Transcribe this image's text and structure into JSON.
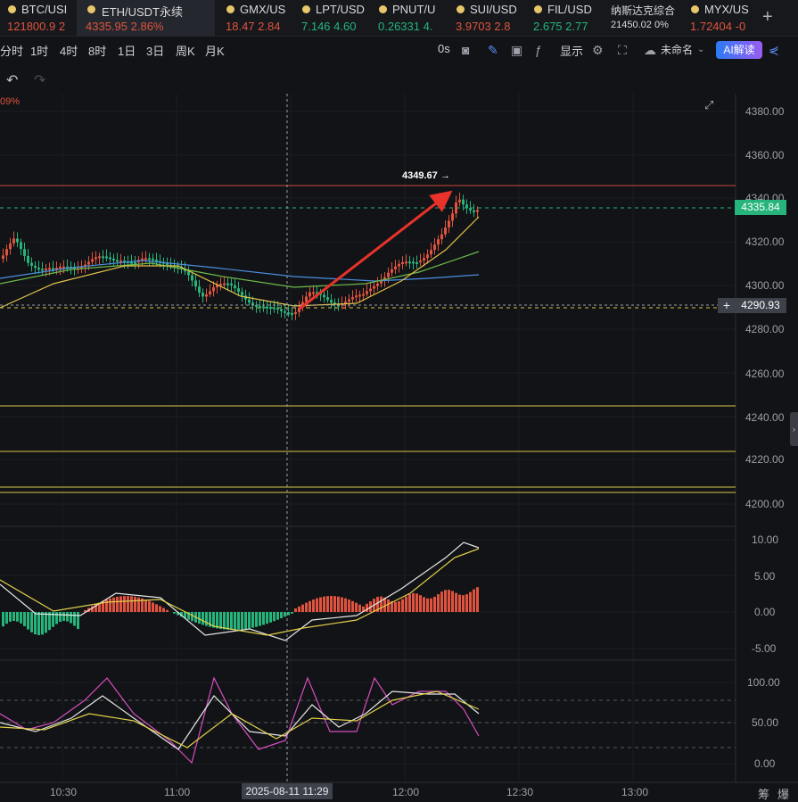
{
  "tabs": [
    {
      "symbol": "BTC/USI",
      "price": "121800.9",
      "change": "2",
      "color": "#e0533e",
      "active": false
    },
    {
      "symbol": "ETH/USDT永续",
      "price": "4335.95",
      "change": "2.86%",
      "color": "#e0533e",
      "active": true
    },
    {
      "symbol": "GMX/US",
      "price": "18.47",
      "change": "2.84",
      "color": "#e0533e",
      "active": false
    },
    {
      "symbol": "LPT/USD",
      "price": "7.146",
      "change": "4.60",
      "color": "#26b47b",
      "active": false
    },
    {
      "symbol": "PNUT/U",
      "price": "0.26331",
      "change": "4.",
      "color": "#26b47b",
      "active": false
    },
    {
      "symbol": "SUI/USD",
      "price": "3.9703",
      "change": "2.8",
      "color": "#e0533e",
      "active": false
    },
    {
      "symbol": "FIL/USD",
      "price": "2.675",
      "change": "2.77",
      "color": "#26b47b",
      "active": false
    },
    {
      "symbol": "纳斯达克综合",
      "price": "21450.02",
      "change": "0%",
      "color": "#d7d9de",
      "active": false
    },
    {
      "symbol": "MYX/US",
      "price": "1.72404",
      "change": "-0",
      "color": "#e0533e",
      "active": false
    }
  ],
  "toolbar": {
    "timeframes": [
      "分时",
      "1时",
      "4时",
      "8时",
      "1日",
      "3日",
      "周K",
      "月K"
    ],
    "countdown": "0s",
    "display_label": "显示",
    "layout_name": "未命名",
    "ai_label": "AI解读"
  },
  "chart": {
    "change_pct": "09%",
    "price_labels": [
      "4380.00",
      "4360.00",
      "4340.00",
      "4320.00",
      "4300.00",
      "4280.00",
      "4260.00",
      "4240.00",
      "4220.00",
      "4200.00"
    ],
    "macd_labels": [
      "10.00",
      "5.00",
      "0.00",
      "-5.00"
    ],
    "kdj_labels": [
      "100.00",
      "50.00",
      "0.00"
    ],
    "time_labels": [
      "10:30",
      "11:00",
      "12:00",
      "12:30",
      "13:00"
    ],
    "crosshair_time": "2025-08-11 11:29",
    "high_label": "4349.67 →",
    "last_price": "4335.84",
    "cursor_price": "4290.93",
    "corner_labels": [
      "筹",
      "爆"
    ],
    "colors": {
      "up": "#e0533e",
      "down": "#26b47b",
      "last": "#26b47b"
    }
  }
}
